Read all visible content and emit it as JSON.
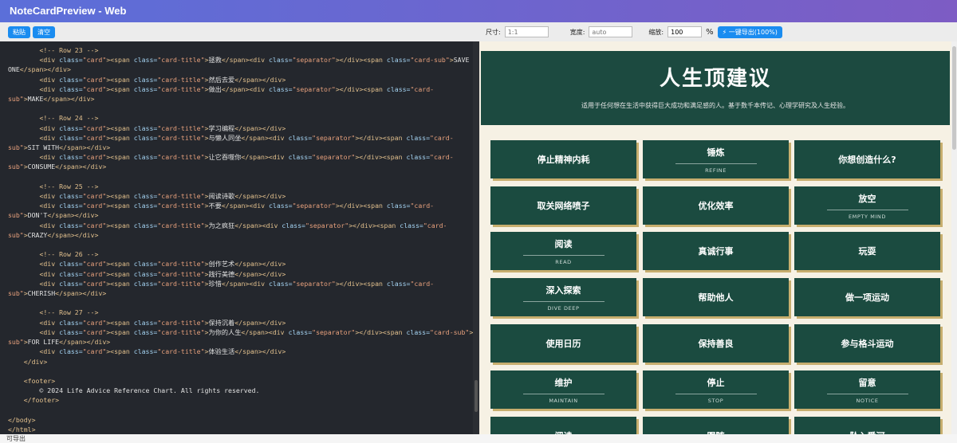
{
  "app": {
    "title": "NoteCardPreview - Web"
  },
  "toolbar": {
    "paste_label": "粘贴",
    "clear_label": "清空",
    "size_label": "尺寸:",
    "size_placeholder": "1:1",
    "width_label": "宽度:",
    "width_placeholder": "auto",
    "zoom_label": "缩放:",
    "zoom_value": "100",
    "percent": "%",
    "export_label": "⚡ 一键导出(100%)"
  },
  "editor": {
    "language": "html"
  },
  "preview": {
    "title": "人生顶建议",
    "subtitle": "适用于任何想在生活中获得巨大成功和满足感的人。基于数千本传记、心理学研究及人生经验。",
    "cards": [
      {
        "title": "停止精神内耗",
        "sub": ""
      },
      {
        "title": "锤炼",
        "sub": "REFINE"
      },
      {
        "title": "你想创造什么?",
        "sub": ""
      },
      {
        "title": "取关网络喷子",
        "sub": ""
      },
      {
        "title": "优化效率",
        "sub": ""
      },
      {
        "title": "放空",
        "sub": "EMPTY MIND"
      },
      {
        "title": "阅读",
        "sub": "READ"
      },
      {
        "title": "真诚行事",
        "sub": ""
      },
      {
        "title": "玩耍",
        "sub": ""
      },
      {
        "title": "深入探索",
        "sub": "DIVE DEEP"
      },
      {
        "title": "帮助他人",
        "sub": ""
      },
      {
        "title": "做一项运动",
        "sub": ""
      },
      {
        "title": "使用日历",
        "sub": ""
      },
      {
        "title": "保持善良",
        "sub": ""
      },
      {
        "title": "参与格斗运动",
        "sub": ""
      },
      {
        "title": "维护",
        "sub": "MAINTAIN"
      },
      {
        "title": "停止",
        "sub": "STOP"
      },
      {
        "title": "留意",
        "sub": "NOTICE"
      },
      {
        "title": "阅读",
        "sub": ""
      },
      {
        "title": "跟随",
        "sub": ""
      },
      {
        "title": "坠入爱河",
        "sub": ""
      }
    ]
  },
  "status": {
    "text": "可导出"
  },
  "colors": {
    "card_bg": "#1b4b40",
    "card_shadow": "#c7ae6e",
    "accent": "#1a8cf0"
  }
}
